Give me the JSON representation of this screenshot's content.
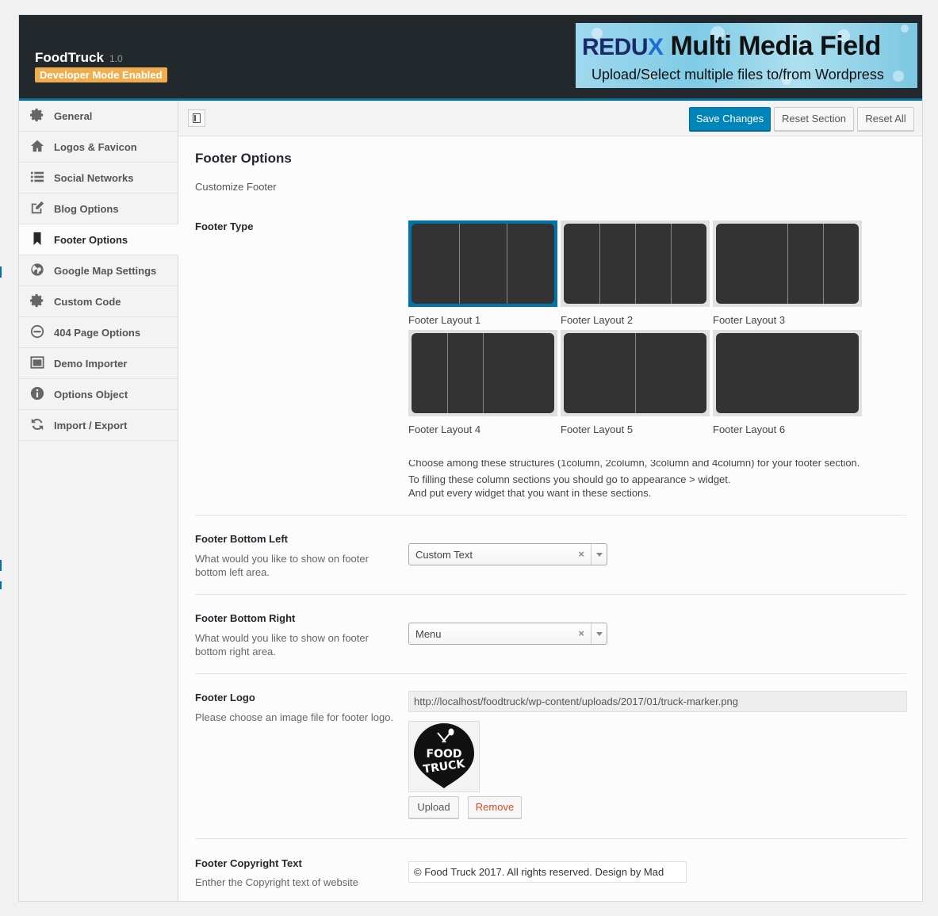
{
  "header": {
    "app_name": "FoodTruck",
    "version": "1.0",
    "dev_badge": "Developer Mode Enabled",
    "banner": {
      "brand_pre": "REDU",
      "brand_x": "X",
      "title": " Multi Media Field",
      "subtitle": "Upload/Select multiple files to/from Wordpress"
    }
  },
  "sidebar": {
    "items": [
      {
        "label": "General",
        "icon": "gear-icon"
      },
      {
        "label": "Logos & Favicon",
        "icon": "home-icon"
      },
      {
        "label": "Social Networks",
        "icon": "list-icon"
      },
      {
        "label": "Blog Options",
        "icon": "edit-icon"
      },
      {
        "label": "Footer Options",
        "icon": "bookmark-icon",
        "active": true
      },
      {
        "label": "Google Map Settings",
        "icon": "globe-icon"
      },
      {
        "label": "Custom Code",
        "icon": "gear-icon"
      },
      {
        "label": "404 Page Options",
        "icon": "minus-circle-icon"
      },
      {
        "label": "Demo Importer",
        "icon": "window-icon"
      },
      {
        "label": "Options Object",
        "icon": "info-icon"
      },
      {
        "label": "Import / Export",
        "icon": "refresh-icon"
      }
    ]
  },
  "toolbar": {
    "save_label": "Save Changes",
    "reset_section_label": "Reset Section",
    "reset_all_label": "Reset All"
  },
  "section": {
    "title": "Footer Options",
    "description": "Customize Footer"
  },
  "footer_type": {
    "title": "Footer Type",
    "layouts": [
      {
        "label": "Footer Layout 1",
        "columns": 3,
        "selected": true
      },
      {
        "label": "Footer Layout 2",
        "columns": 4
      },
      {
        "label": "Footer Layout 3",
        "columns": 3
      },
      {
        "label": "Footer Layout 4",
        "columns": 3
      },
      {
        "label": "Footer Layout 5",
        "columns": 2
      },
      {
        "label": "Footer Layout 6",
        "columns": 1
      }
    ],
    "help_line1": "Choose among these structures (1column, 2column, 3column and 4column) for your footer section.",
    "help_line2": "To filling these column sections you should go to appearance > widget.",
    "help_line3": "And put every widget that you want in these sections."
  },
  "bottom_left": {
    "title": "Footer Bottom Left",
    "description": "What would you like to show on footer bottom left area.",
    "value": "Custom Text"
  },
  "bottom_right": {
    "title": "Footer Bottom Right",
    "description": "What would you like to show on footer bottom right area.",
    "value": "Menu"
  },
  "logo": {
    "title": "Footer Logo",
    "description": "Please choose an image file for footer logo.",
    "url": "http://localhost/foodtruck/wp-content/uploads/2017/01/truck-marker.png",
    "logo_text_1": "FOOD",
    "logo_text_2": "TRUCK",
    "upload_label": "Upload",
    "remove_label": "Remove"
  },
  "copyright": {
    "title": "Footer Copyright Text",
    "description": "Enther the Copyright text of website",
    "value": "© Food Truck 2017. All rights reserved. Design by Mad"
  },
  "colors": {
    "accent": "#0073aa",
    "header_bg": "#23282d",
    "badge": "#f0ad4e",
    "remove": "#d54e21"
  }
}
